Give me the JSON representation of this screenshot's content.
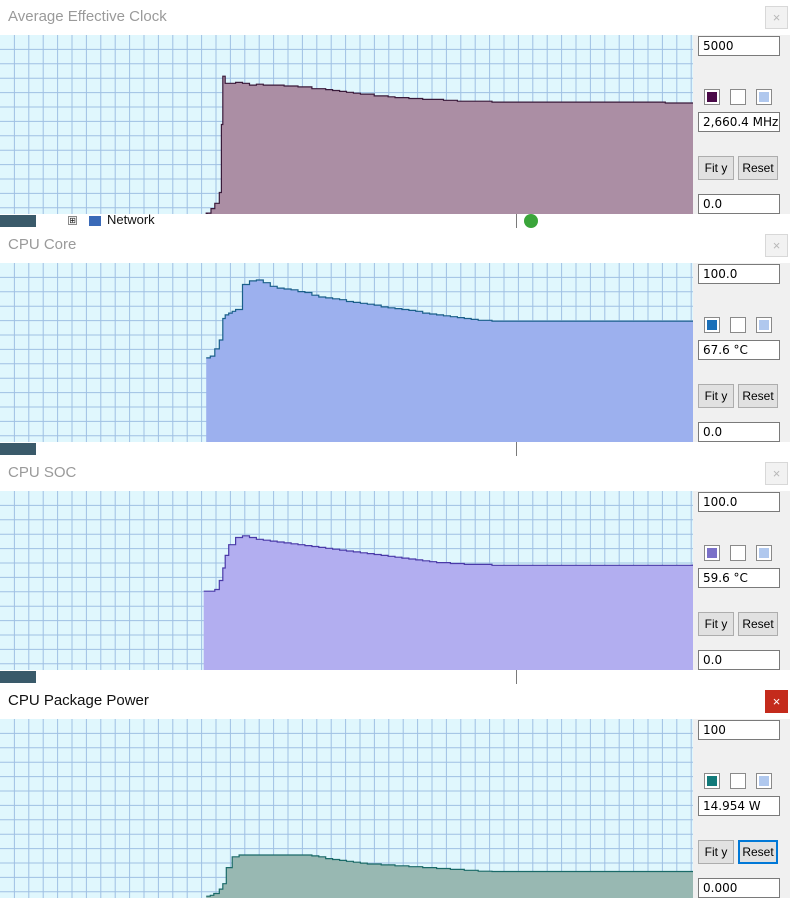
{
  "panels": [
    {
      "title": "Average Effective Clock",
      "active": false,
      "close_label": "×",
      "max": "5000",
      "current": "2,660.4 MHz",
      "min": "0.0",
      "fit_label": "Fit y",
      "reset_label": "Reset",
      "line_color": "#3a1a3a",
      "fill_color": "#ab8ea4",
      "swatch_color": "#4a0a48",
      "background_row": {
        "expander": "⊞",
        "text": "Network"
      },
      "chart_data": {
        "type": "area",
        "ylim": [
          0,
          5000
        ],
        "grid": true,
        "samples": [
          [
            0.3,
            0
          ],
          [
            0.2975,
            0.5
          ],
          [
            0.3045,
            3
          ],
          [
            0.31,
            6
          ],
          [
            0.3165,
            12
          ],
          [
            0.3195,
            50
          ],
          [
            0.3215,
            77
          ],
          [
            0.325,
            73
          ],
          [
            0.33,
            73
          ],
          [
            0.34,
            73.5
          ],
          [
            0.35,
            73
          ],
          [
            0.36,
            72
          ],
          [
            0.37,
            72.5
          ],
          [
            0.38,
            72
          ],
          [
            0.39,
            72
          ],
          [
            0.4,
            72
          ],
          [
            0.41,
            71.5
          ],
          [
            0.42,
            71.5
          ],
          [
            0.43,
            71
          ],
          [
            0.44,
            71
          ],
          [
            0.45,
            70
          ],
          [
            0.46,
            70
          ],
          [
            0.47,
            69.5
          ],
          [
            0.48,
            69
          ],
          [
            0.49,
            68.5
          ],
          [
            0.5,
            68
          ],
          [
            0.51,
            67.5
          ],
          [
            0.52,
            67
          ],
          [
            0.53,
            67
          ],
          [
            0.54,
            66
          ],
          [
            0.55,
            66
          ],
          [
            0.56,
            65.5
          ],
          [
            0.57,
            65
          ],
          [
            0.58,
            65
          ],
          [
            0.59,
            64.5
          ],
          [
            0.6,
            64.5
          ],
          [
            0.61,
            64
          ],
          [
            0.62,
            64
          ],
          [
            0.63,
            64
          ],
          [
            0.64,
            63.5
          ],
          [
            0.65,
            63.5
          ],
          [
            0.66,
            63
          ],
          [
            0.67,
            63
          ],
          [
            0.68,
            63
          ],
          [
            0.69,
            63
          ],
          [
            0.7,
            63
          ],
          [
            0.71,
            62.5
          ],
          [
            0.72,
            62.5
          ],
          [
            0.73,
            62.5
          ],
          [
            0.74,
            62.5
          ],
          [
            0.75,
            62.5
          ],
          [
            0.76,
            62.5
          ],
          [
            0.77,
            62.5
          ],
          [
            0.78,
            62.5
          ],
          [
            0.79,
            62.5
          ],
          [
            0.8,
            62.5
          ],
          [
            0.81,
            62.5
          ],
          [
            0.82,
            62.5
          ],
          [
            0.83,
            62.5
          ],
          [
            0.84,
            62.5
          ],
          [
            0.85,
            62.5
          ],
          [
            0.86,
            62.5
          ],
          [
            0.87,
            62.5
          ],
          [
            0.88,
            62.5
          ],
          [
            0.89,
            62.5
          ],
          [
            0.9,
            62.5
          ],
          [
            0.91,
            62.5
          ],
          [
            0.92,
            62.5
          ],
          [
            0.93,
            62.5
          ],
          [
            0.94,
            62.5
          ],
          [
            0.95,
            62.5
          ],
          [
            0.96,
            62
          ],
          [
            0.97,
            62
          ],
          [
            0.98,
            62
          ],
          [
            0.99,
            62
          ],
          [
            1.0,
            62
          ]
        ]
      }
    },
    {
      "title": "CPU Core",
      "active": false,
      "close_label": "×",
      "max": "100.0",
      "current": "67.6 °C",
      "min": "0.0",
      "fit_label": "Fit y",
      "reset_label": "Reset",
      "line_color": "#1a5f8a",
      "fill_color": "#9cb0ee",
      "swatch_color": "#1a6fb8",
      "background_row": {
        "expander": "",
        "text": ""
      },
      "chart_data": {
        "type": "area",
        "ylim": [
          0,
          100
        ],
        "grid": true,
        "samples": [
          [
            0.2975,
            47
          ],
          [
            0.3035,
            48
          ],
          [
            0.31,
            52
          ],
          [
            0.3165,
            57
          ],
          [
            0.3215,
            69
          ],
          [
            0.325,
            71
          ],
          [
            0.33,
            72
          ],
          [
            0.335,
            73
          ],
          [
            0.34,
            74
          ],
          [
            0.35,
            88
          ],
          [
            0.36,
            90
          ],
          [
            0.37,
            90.5
          ],
          [
            0.38,
            89
          ],
          [
            0.39,
            87
          ],
          [
            0.4,
            86
          ],
          [
            0.41,
            85.5
          ],
          [
            0.42,
            85
          ],
          [
            0.43,
            84
          ],
          [
            0.44,
            83.5
          ],
          [
            0.45,
            82
          ],
          [
            0.46,
            81
          ],
          [
            0.47,
            80.5
          ],
          [
            0.48,
            80
          ],
          [
            0.49,
            79.5
          ],
          [
            0.5,
            78.5
          ],
          [
            0.51,
            78
          ],
          [
            0.52,
            77.5
          ],
          [
            0.53,
            77
          ],
          [
            0.54,
            76.5
          ],
          [
            0.55,
            75.5
          ],
          [
            0.56,
            75
          ],
          [
            0.57,
            74.5
          ],
          [
            0.58,
            74
          ],
          [
            0.59,
            73.5
          ],
          [
            0.6,
            73
          ],
          [
            0.61,
            72
          ],
          [
            0.62,
            71.5
          ],
          [
            0.63,
            71
          ],
          [
            0.64,
            70.5
          ],
          [
            0.65,
            70
          ],
          [
            0.66,
            69.5
          ],
          [
            0.67,
            69
          ],
          [
            0.68,
            68.5
          ],
          [
            0.69,
            68
          ],
          [
            0.7,
            68
          ],
          [
            0.71,
            67.5
          ],
          [
            0.72,
            67.5
          ],
          [
            0.73,
            67.5
          ],
          [
            0.74,
            67.5
          ],
          [
            0.75,
            67.5
          ],
          [
            0.76,
            67.5
          ],
          [
            0.77,
            67.5
          ],
          [
            0.78,
            67.5
          ],
          [
            0.79,
            67.5
          ],
          [
            0.8,
            67.5
          ],
          [
            0.81,
            67.5
          ],
          [
            0.82,
            67.5
          ],
          [
            0.83,
            67.5
          ],
          [
            0.84,
            67.5
          ],
          [
            0.85,
            67.5
          ],
          [
            0.86,
            67.5
          ],
          [
            0.87,
            67.5
          ],
          [
            0.88,
            67.5
          ],
          [
            0.89,
            67.5
          ],
          [
            0.9,
            67.5
          ],
          [
            0.91,
            67.5
          ],
          [
            0.92,
            67.5
          ],
          [
            0.93,
            67.5
          ],
          [
            0.94,
            67.5
          ],
          [
            0.95,
            67.5
          ],
          [
            0.96,
            67.5
          ],
          [
            0.97,
            67.5
          ],
          [
            0.98,
            67.5
          ],
          [
            0.99,
            67.5
          ],
          [
            1.0,
            67.6
          ]
        ]
      }
    },
    {
      "title": "CPU SOC",
      "active": false,
      "close_label": "×",
      "max": "100.0",
      "current": "59.6 °C",
      "min": "0.0",
      "fit_label": "Fit y",
      "reset_label": "Reset",
      "line_color": "#4a3aa8",
      "fill_color": "#b2aef0",
      "swatch_color": "#7a70c8",
      "background_row": {
        "expander": "",
        "text": ""
      },
      "chart_data": {
        "type": "area",
        "ylim": [
          0,
          100
        ],
        "grid": true,
        "samples": [
          [
            0.294,
            44
          ],
          [
            0.3,
            44
          ],
          [
            0.31,
            45
          ],
          [
            0.3165,
            50
          ],
          [
            0.3215,
            57
          ],
          [
            0.325,
            64
          ],
          [
            0.33,
            70
          ],
          [
            0.34,
            74
          ],
          [
            0.35,
            75
          ],
          [
            0.36,
            74
          ],
          [
            0.37,
            73
          ],
          [
            0.38,
            72.5
          ],
          [
            0.39,
            72
          ],
          [
            0.4,
            71.5
          ],
          [
            0.41,
            71
          ],
          [
            0.42,
            70.5
          ],
          [
            0.43,
            70
          ],
          [
            0.44,
            69.5
          ],
          [
            0.45,
            69
          ],
          [
            0.46,
            68.5
          ],
          [
            0.47,
            68
          ],
          [
            0.48,
            67.5
          ],
          [
            0.49,
            67
          ],
          [
            0.5,
            66.5
          ],
          [
            0.51,
            66
          ],
          [
            0.52,
            65.5
          ],
          [
            0.53,
            65
          ],
          [
            0.54,
            64.5
          ],
          [
            0.55,
            64
          ],
          [
            0.56,
            63.5
          ],
          [
            0.57,
            63
          ],
          [
            0.58,
            62.5
          ],
          [
            0.59,
            62
          ],
          [
            0.6,
            61.5
          ],
          [
            0.61,
            61
          ],
          [
            0.62,
            60.5
          ],
          [
            0.63,
            60
          ],
          [
            0.64,
            60
          ],
          [
            0.65,
            59.5
          ],
          [
            0.66,
            59.5
          ],
          [
            0.67,
            59
          ],
          [
            0.68,
            59
          ],
          [
            0.69,
            59
          ],
          [
            0.7,
            59
          ],
          [
            0.71,
            58.5
          ],
          [
            0.72,
            58.5
          ],
          [
            0.73,
            58.5
          ],
          [
            0.74,
            58.5
          ],
          [
            0.75,
            58.5
          ],
          [
            0.76,
            58.5
          ],
          [
            0.77,
            58.5
          ],
          [
            0.78,
            58.5
          ],
          [
            0.79,
            58.5
          ],
          [
            0.8,
            58.5
          ],
          [
            0.81,
            58.5
          ],
          [
            0.82,
            58.5
          ],
          [
            0.83,
            58.5
          ],
          [
            0.84,
            58.5
          ],
          [
            0.85,
            58.5
          ],
          [
            0.86,
            58.5
          ],
          [
            0.87,
            58.5
          ],
          [
            0.88,
            58.5
          ],
          [
            0.89,
            58.5
          ],
          [
            0.9,
            58.5
          ],
          [
            0.91,
            58.5
          ],
          [
            0.92,
            58.5
          ],
          [
            0.93,
            58.5
          ],
          [
            0.94,
            58.5
          ],
          [
            0.95,
            58.5
          ],
          [
            0.96,
            58.5
          ],
          [
            0.97,
            58.5
          ],
          [
            0.98,
            58.5
          ],
          [
            0.99,
            58.5
          ],
          [
            1.0,
            59
          ]
        ]
      }
    },
    {
      "title": "CPU Package Power",
      "active": true,
      "close_label": "×",
      "max": "100",
      "current": "14.954 W",
      "min": "0.000",
      "fit_label": "Fit y",
      "reset_label": "Reset",
      "line_color": "#1a6a68",
      "fill_color": "#98b8b2",
      "swatch_color": "#127a7a",
      "background_row": {
        "expander": "",
        "text": ""
      },
      "chart_data": {
        "type": "area",
        "ylim": [
          0,
          100
        ],
        "grid": true,
        "samples": [
          [
            0.2975,
            1
          ],
          [
            0.3035,
            1.5
          ],
          [
            0.3085,
            2.5
          ],
          [
            0.3165,
            5
          ],
          [
            0.3215,
            8
          ],
          [
            0.3265,
            17
          ],
          [
            0.335,
            23
          ],
          [
            0.345,
            24
          ],
          [
            0.36,
            24
          ],
          [
            0.38,
            24
          ],
          [
            0.4,
            24
          ],
          [
            0.42,
            24
          ],
          [
            0.44,
            24
          ],
          [
            0.45,
            23.5
          ],
          [
            0.46,
            23
          ],
          [
            0.47,
            22
          ],
          [
            0.48,
            21.5
          ],
          [
            0.49,
            21
          ],
          [
            0.5,
            20.5
          ],
          [
            0.51,
            20
          ],
          [
            0.52,
            19.5
          ],
          [
            0.53,
            19
          ],
          [
            0.54,
            19
          ],
          [
            0.55,
            18.5
          ],
          [
            0.56,
            18.5
          ],
          [
            0.57,
            18
          ],
          [
            0.58,
            18
          ],
          [
            0.59,
            17.5
          ],
          [
            0.6,
            17.5
          ],
          [
            0.61,
            17
          ],
          [
            0.62,
            17
          ],
          [
            0.63,
            16.5
          ],
          [
            0.64,
            16.5
          ],
          [
            0.65,
            16
          ],
          [
            0.66,
            16
          ],
          [
            0.67,
            15.5
          ],
          [
            0.68,
            15.5
          ],
          [
            0.69,
            15
          ],
          [
            0.7,
            15
          ],
          [
            0.71,
            14.8
          ],
          [
            0.72,
            14.8
          ],
          [
            0.73,
            14.8
          ],
          [
            0.74,
            14.8
          ],
          [
            0.75,
            14.8
          ],
          [
            0.76,
            14.8
          ],
          [
            0.77,
            14.8
          ],
          [
            0.78,
            14.8
          ],
          [
            0.79,
            14.8
          ],
          [
            0.8,
            14.8
          ],
          [
            0.81,
            14.8
          ],
          [
            0.82,
            14.8
          ],
          [
            0.83,
            14.8
          ],
          [
            0.84,
            14.8
          ],
          [
            0.85,
            14.8
          ],
          [
            0.86,
            14.8
          ],
          [
            0.87,
            14.8
          ],
          [
            0.88,
            14.8
          ],
          [
            0.89,
            14.8
          ],
          [
            0.9,
            14.8
          ],
          [
            0.91,
            14.8
          ],
          [
            0.92,
            14.8
          ],
          [
            0.93,
            14.8
          ],
          [
            0.94,
            14.8
          ],
          [
            0.95,
            14.8
          ],
          [
            0.96,
            14.8
          ],
          [
            0.97,
            14.8
          ],
          [
            0.98,
            14.8
          ],
          [
            0.99,
            14.8
          ],
          [
            1.0,
            14.954
          ]
        ]
      }
    }
  ],
  "colors": {
    "graph_background": "#e0f7fd",
    "grid_line": "#9fc0e3",
    "close_active": "#c42b1c",
    "focus_border": "#0078d7",
    "swatch_white": "#ffffff",
    "swatch_light_blue": "#b0c8ee"
  },
  "icons": [
    "close-icon",
    "color-swatch",
    "tree-expander-icon",
    "network-icon",
    "status-dot-icon"
  ]
}
